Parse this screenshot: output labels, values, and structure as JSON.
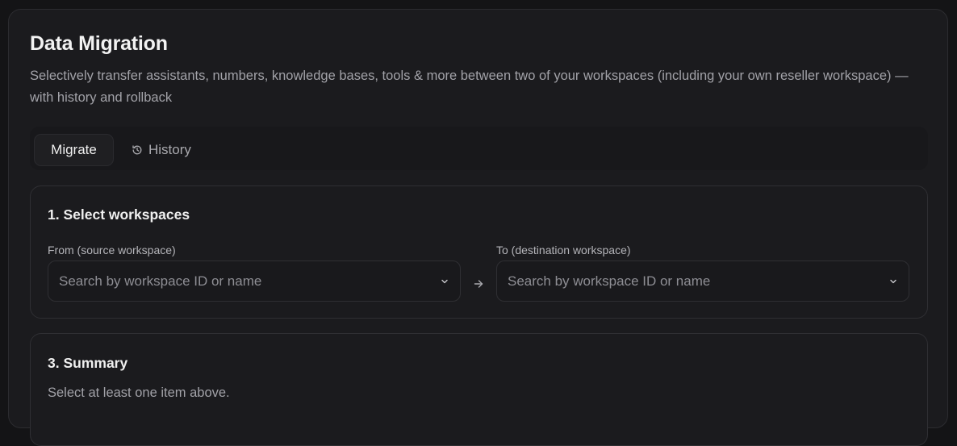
{
  "header": {
    "title": "Data Migration",
    "subtitle": "Selectively transfer assistants, numbers, knowledge bases, tools & more between two of your workspaces (including your own reseller workspace) — with history and rollback"
  },
  "tabs": [
    {
      "label": "Migrate",
      "active": true
    },
    {
      "label": "History",
      "icon": "history-icon",
      "active": false
    }
  ],
  "step1": {
    "title": "1. Select workspaces",
    "from": {
      "label": "From (source workspace)",
      "placeholder": "Search by workspace ID or name"
    },
    "to": {
      "label": "To (destination workspace)",
      "placeholder": "Search by workspace ID or name"
    },
    "arrow_icon": "arrow-right-icon"
  },
  "summary": {
    "title": "3. Summary",
    "text": "Select at least one item above."
  },
  "colors": {
    "background": "#141416",
    "panel": "#1b1b1e",
    "border": "#2f2f33",
    "text_primary": "#f0f0f0",
    "text_muted": "#a2a2a8"
  }
}
